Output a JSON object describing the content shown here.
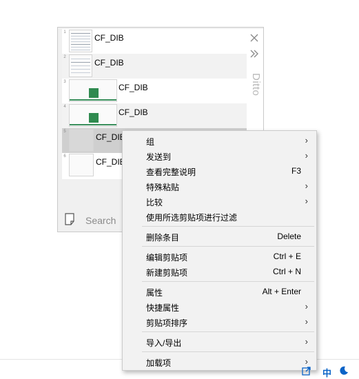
{
  "window": {
    "title": "Ditto",
    "close_icon": "close-icon",
    "expand_icon": "double-chevron-icon"
  },
  "clips": [
    {
      "number": "1",
      "label": "CF_DIB"
    },
    {
      "number": "2",
      "label": "CF_DIB"
    },
    {
      "number": "3",
      "label": "CF_DIB"
    },
    {
      "number": "4",
      "label": "CF_DIB"
    },
    {
      "number": "5",
      "label": "CF_DIB"
    },
    {
      "number": "6",
      "label": "CF_DIB"
    }
  ],
  "search": {
    "placeholder": "Search",
    "icon": "note-icon"
  },
  "context_menu": {
    "items": [
      {
        "label": "组",
        "shortcut": "",
        "submenu": true
      },
      {
        "label": "发送到",
        "shortcut": "",
        "submenu": true
      },
      {
        "label": "查看完整说明",
        "shortcut": "F3",
        "submenu": false
      },
      {
        "label": "特殊粘贴",
        "shortcut": "",
        "submenu": true
      },
      {
        "label": "比较",
        "shortcut": "",
        "submenu": true
      },
      {
        "label": "使用所选剪贴项进行过滤",
        "shortcut": "",
        "submenu": false
      },
      {
        "label": "删除条目",
        "shortcut": "Delete",
        "submenu": false
      },
      {
        "label": "编辑剪贴项",
        "shortcut": "Ctrl + E",
        "submenu": false
      },
      {
        "label": "新建剪贴项",
        "shortcut": "Ctrl + N",
        "submenu": false
      },
      {
        "label": "属性",
        "shortcut": "Alt + Enter",
        "submenu": false
      },
      {
        "label": "快捷属性",
        "shortcut": "",
        "submenu": true
      },
      {
        "label": "剪贴项排序",
        "shortcut": "",
        "submenu": true
      },
      {
        "label": "导入/导出",
        "shortcut": "",
        "submenu": true
      },
      {
        "label": "加载项",
        "shortcut": "",
        "submenu": true
      }
    ],
    "submenu_arrow": "›"
  },
  "tray": {
    "ime_mode": "中",
    "moon_icon": "moon-icon"
  },
  "colors": {
    "menu_bg": "#f2f2f2",
    "selected_row": "#cfcfcf",
    "tray_blue": "#0a63c7",
    "thumb_green": "#2f8a4f"
  }
}
